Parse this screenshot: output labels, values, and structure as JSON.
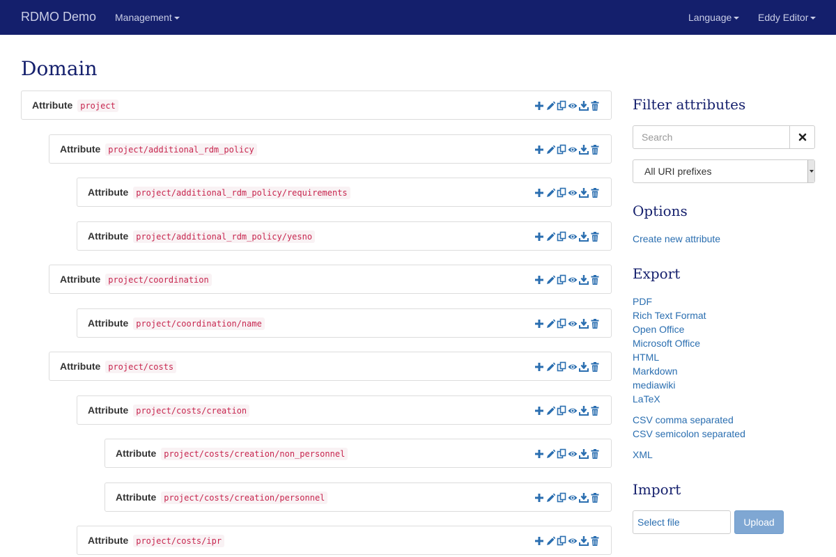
{
  "navbar": {
    "brand": "RDMO Demo",
    "management": "Management",
    "language": "Language",
    "user": "Eddy Editor"
  },
  "page_title": "Domain",
  "attributes": [
    {
      "label": "Attribute",
      "uri": "project"
    },
    {
      "label": "Attribute",
      "uri": "project/additional_rdm_policy"
    },
    {
      "label": "Attribute",
      "uri": "project/additional_rdm_policy/requirements"
    },
    {
      "label": "Attribute",
      "uri": "project/additional_rdm_policy/yesno"
    },
    {
      "label": "Attribute",
      "uri": "project/coordination"
    },
    {
      "label": "Attribute",
      "uri": "project/coordination/name"
    },
    {
      "label": "Attribute",
      "uri": "project/costs"
    },
    {
      "label": "Attribute",
      "uri": "project/costs/creation"
    },
    {
      "label": "Attribute",
      "uri": "project/costs/creation/non_personnel"
    },
    {
      "label": "Attribute",
      "uri": "project/costs/creation/personnel"
    },
    {
      "label": "Attribute",
      "uri": "project/costs/ipr"
    }
  ],
  "action_icons": [
    "plus-icon",
    "pencil-icon",
    "copy-icon",
    "eye-icon",
    "download-icon",
    "trash-icon"
  ],
  "sidebar": {
    "filter_title": "Filter attributes",
    "search_placeholder": "Search",
    "uri_prefix_selected": "All URI prefixes",
    "options_title": "Options",
    "create_link": "Create new attribute",
    "export_title": "Export",
    "export_links": [
      "PDF",
      "Rich Text Format",
      "Open Office",
      "Microsoft Office",
      "HTML",
      "Markdown",
      "mediawiki",
      "LaTeX",
      "CSV comma separated",
      "CSV semicolon separated",
      "XML"
    ],
    "import_title": "Import",
    "select_file": "Select file",
    "upload": "Upload"
  },
  "colors": {
    "navbar_bg": "#141f6c",
    "heading": "#141f6c",
    "link": "#2a6eb0",
    "code_text": "#c7254e",
    "code_bg": "#f9f2f4",
    "upload_bg": "#7fa7d3"
  }
}
